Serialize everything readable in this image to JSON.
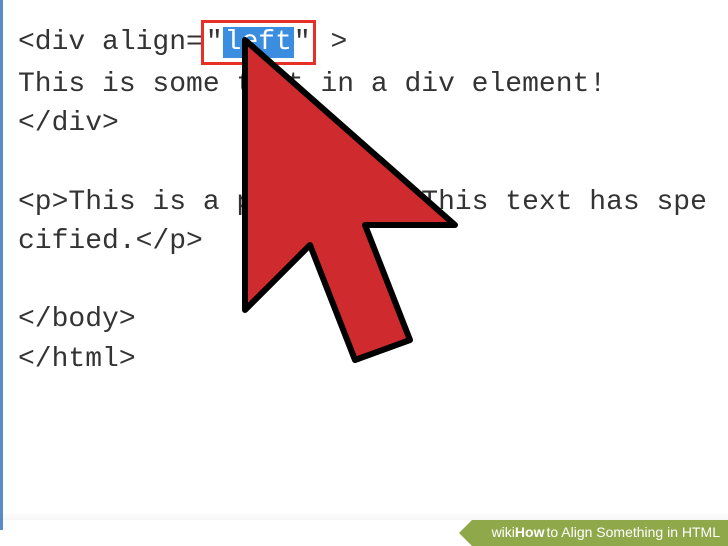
{
  "code": {
    "line1_prefix": "<div align=",
    "line1_quote_open": "\"",
    "line1_selected": "left",
    "line1_quote_close": "\"",
    "line1_suffix": " >",
    "line2": "This is some text in a div element!",
    "line3": "</div>",
    "line4": "",
    "line5": "<p>This is a paragraph. This text has specified.</p>",
    "line6": "",
    "line7": "</body>",
    "line8": "</html>"
  },
  "footer": {
    "brand_prefix": "wiki",
    "brand_bold": "How",
    "article_title": " to Align Something in HTML"
  },
  "highlight": {
    "border_color": "#e63027",
    "selection_bg": "#3b8de0"
  },
  "cursor": {
    "fill": "#cf2a2e",
    "stroke": "#000000"
  }
}
